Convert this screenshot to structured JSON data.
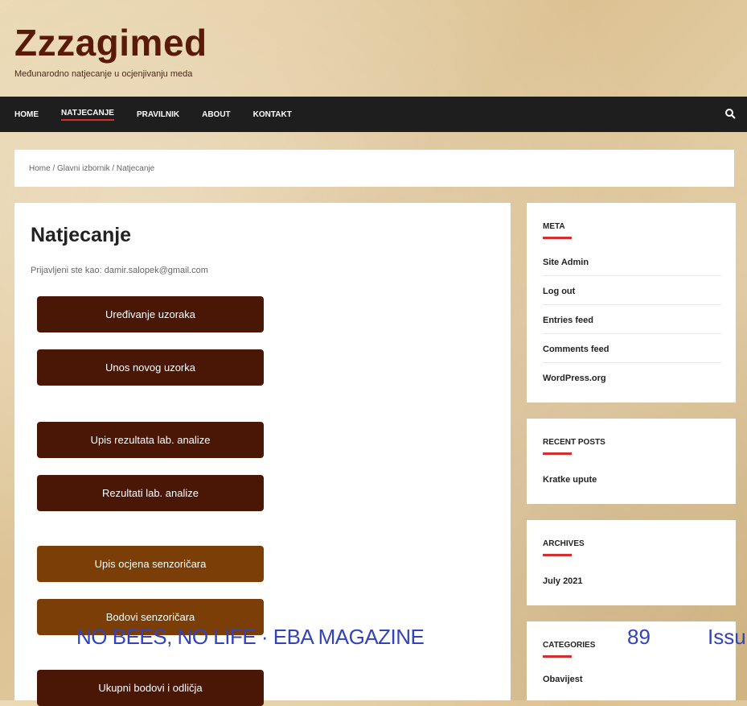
{
  "site": {
    "title": "Zzzagimed",
    "tagline": "Međunarodno natjecanje u ocjenjivanju meda"
  },
  "nav": {
    "items": [
      "HOME",
      "NATJECANJE",
      "PRAVILNIK",
      "ABOUT",
      "KONTAKT"
    ],
    "active": 1
  },
  "breadcrumb": {
    "text": "Home / Glavni izbornik / Natjecanje"
  },
  "main": {
    "title": "Natjecanje",
    "login": "Prijavljeni ste kao: damir.salopek@gmail.com",
    "buttons": [
      "Uređivanje uzoraka",
      "Unos novog uzorka",
      "Upis rezultata lab. analize",
      "Rezultati lab. analize",
      "Upis ocjena senzoričara",
      "Bodovi senzoričara",
      "Ukupni bodovi i odličja"
    ]
  },
  "overlay": {
    "left": "NO BEES, NO LIFE · EBA MAGAZINE",
    "page": "89",
    "right": "Issu"
  },
  "sidebar": {
    "meta": {
      "title": "META",
      "items": [
        "Site Admin",
        "Log out",
        "Entries feed",
        "Comments feed",
        "WordPress.org"
      ]
    },
    "recent": {
      "title": "RECENT POSTS",
      "items": [
        "Kratke upute"
      ]
    },
    "archives": {
      "title": "ARCHIVES",
      "items": [
        "July 2021"
      ]
    },
    "categories": {
      "title": "CATEGORIES",
      "items": [
        "Obavijest"
      ]
    }
  },
  "colors": {
    "nav_bg": "#1e1e1e",
    "button_dark": "#4a1606",
    "button_orange": "#7a3e06",
    "accent": "#d32f2f"
  }
}
